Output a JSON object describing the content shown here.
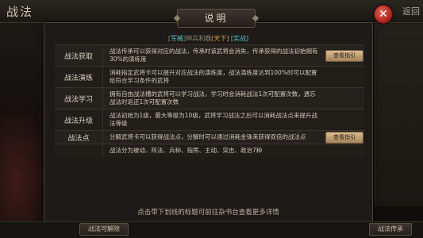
{
  "top": {
    "title": "战法",
    "tabs_hint": "",
    "return_label": "返回"
  },
  "modal": {
    "title": "说明",
    "subtitle": {
      "prefix": "[",
      "tag1": "军械",
      "middle": "]神兵利器",
      "tag2": "[天下]",
      "suffix": "[实战]"
    },
    "rows": [
      {
        "label": "战法获取",
        "desc": "战法传承可以获得对应的战法，传承时该武将会消失，传承获得的战法初始拥有30%的演练度",
        "button": "查看指引"
      },
      {
        "label": "战法演练",
        "desc": "消耗指定武将卡可以提升对应战法的演练度，战法演练度达到100%时可以配置给符合学习条件的武将",
        "button": ""
      },
      {
        "label": "战法学习",
        "desc": "拥有自由战法槽的武将可以学习战法，学习时会消耗战法1次可配置次数，遗忘战法时返还1次可配置次数",
        "button": ""
      },
      {
        "label": "战法升级",
        "desc": "战法初始为1级，最大等级为10级，武将学习战法之后可以消耗战法点来提升战法等级",
        "button": ""
      },
      {
        "label": "战法点",
        "desc": "分解武将卡可以获得战法点，分解时可以通过消耗金铢来获得双倍的战法点",
        "button": "查看指引"
      },
      {
        "label": "",
        "desc": "战法分为被动、阵法、兵种、指挥、主动、突击、政治7种",
        "button": ""
      }
    ],
    "footer_hint": "点击带下划线的标题可前往杂书台查看更多详情"
  },
  "bottom": {
    "left_button": "战法可解除",
    "right_button": "战法传承"
  },
  "colors": {
    "accent_teal": "#5cc7c9",
    "accent_orange": "#e0a255",
    "close_red": "#b3271f",
    "button_gold": "#d9bb92"
  }
}
